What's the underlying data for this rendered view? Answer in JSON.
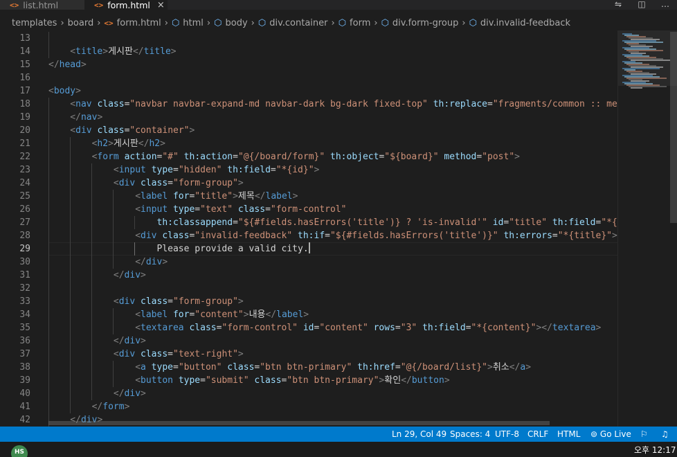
{
  "tabs": [
    {
      "label": "list.html",
      "icon": "html-file-icon",
      "active": false
    },
    {
      "label": "form.html",
      "icon": "html-file-icon",
      "active": true
    }
  ],
  "tab_close_glyph": "×",
  "html_icon_glyph": "<>",
  "breadcrumb": [
    "templates",
    "board",
    "form.html",
    "html",
    "body",
    "div.container",
    "form",
    "div.form-group",
    "div.invalid-feedback"
  ],
  "editor": {
    "active_line": 29,
    "lines": [
      {
        "n": 13,
        "indent": 1,
        "parts": []
      },
      {
        "n": 14,
        "indent": 1,
        "parts": [
          [
            "p",
            "<"
          ],
          [
            "tag",
            "title"
          ],
          [
            "p",
            ">"
          ],
          [
            "txt",
            "게시판"
          ],
          [
            "p",
            "</"
          ],
          [
            "tag",
            "title"
          ],
          [
            "p",
            ">"
          ]
        ]
      },
      {
        "n": 15,
        "indent": 0,
        "parts": [
          [
            "p",
            "</"
          ],
          [
            "tag",
            "head"
          ],
          [
            "p",
            ">"
          ]
        ]
      },
      {
        "n": 16,
        "indent": 0,
        "parts": []
      },
      {
        "n": 17,
        "indent": 0,
        "parts": [
          [
            "p",
            "<"
          ],
          [
            "tag",
            "body"
          ],
          [
            "p",
            ">"
          ]
        ]
      },
      {
        "n": 18,
        "indent": 1,
        "parts": [
          [
            "p",
            "<"
          ],
          [
            "tag",
            "nav"
          ],
          [
            "txt",
            " "
          ],
          [
            "attr",
            "class"
          ],
          [
            "eq",
            "="
          ],
          [
            "str",
            "\"navbar navbar-expand-md navbar-dark bg-dark fixed-top\""
          ],
          [
            "txt",
            " "
          ],
          [
            "attr",
            "th:replace"
          ],
          [
            "eq",
            "="
          ],
          [
            "str",
            "\"fragments/common :: menu"
          ]
        ]
      },
      {
        "n": 19,
        "indent": 1,
        "parts": [
          [
            "p",
            "</"
          ],
          [
            "tag",
            "nav"
          ],
          [
            "p",
            ">"
          ]
        ]
      },
      {
        "n": 20,
        "indent": 1,
        "parts": [
          [
            "p",
            "<"
          ],
          [
            "tag",
            "div"
          ],
          [
            "txt",
            " "
          ],
          [
            "attr",
            "class"
          ],
          [
            "eq",
            "="
          ],
          [
            "str",
            "\"container\""
          ],
          [
            "p",
            ">"
          ]
        ]
      },
      {
        "n": 21,
        "indent": 2,
        "parts": [
          [
            "p",
            "<"
          ],
          [
            "tag",
            "h2"
          ],
          [
            "p",
            ">"
          ],
          [
            "txt",
            "게시판"
          ],
          [
            "p",
            "</"
          ],
          [
            "tag",
            "h2"
          ],
          [
            "p",
            ">"
          ]
        ]
      },
      {
        "n": 22,
        "indent": 2,
        "parts": [
          [
            "p",
            "<"
          ],
          [
            "tag",
            "form"
          ],
          [
            "txt",
            " "
          ],
          [
            "attr",
            "action"
          ],
          [
            "eq",
            "="
          ],
          [
            "str",
            "\"#\""
          ],
          [
            "txt",
            " "
          ],
          [
            "attr",
            "th:action"
          ],
          [
            "eq",
            "="
          ],
          [
            "str",
            "\"@{/board/form}\""
          ],
          [
            "txt",
            " "
          ],
          [
            "attr",
            "th:object"
          ],
          [
            "eq",
            "="
          ],
          [
            "str",
            "\"${board}\""
          ],
          [
            "txt",
            " "
          ],
          [
            "attr",
            "method"
          ],
          [
            "eq",
            "="
          ],
          [
            "str",
            "\"post\""
          ],
          [
            "p",
            ">"
          ]
        ]
      },
      {
        "n": 23,
        "indent": 3,
        "parts": [
          [
            "p",
            "<"
          ],
          [
            "tag",
            "input"
          ],
          [
            "txt",
            " "
          ],
          [
            "attr",
            "type"
          ],
          [
            "eq",
            "="
          ],
          [
            "str",
            "\"hidden\""
          ],
          [
            "txt",
            " "
          ],
          [
            "attr",
            "th:field"
          ],
          [
            "eq",
            "="
          ],
          [
            "str",
            "\"*{id}\""
          ],
          [
            "p",
            ">"
          ]
        ]
      },
      {
        "n": 24,
        "indent": 3,
        "parts": [
          [
            "p",
            "<"
          ],
          [
            "tag",
            "div"
          ],
          [
            "txt",
            " "
          ],
          [
            "attr",
            "class"
          ],
          [
            "eq",
            "="
          ],
          [
            "str",
            "\"form-group\""
          ],
          [
            "p",
            ">"
          ]
        ]
      },
      {
        "n": 25,
        "indent": 4,
        "parts": [
          [
            "p",
            "<"
          ],
          [
            "tag",
            "label"
          ],
          [
            "txt",
            " "
          ],
          [
            "attr",
            "for"
          ],
          [
            "eq",
            "="
          ],
          [
            "str",
            "\"title\""
          ],
          [
            "p",
            ">"
          ],
          [
            "txt",
            "제목"
          ],
          [
            "p",
            "</"
          ],
          [
            "tag",
            "label"
          ],
          [
            "p",
            ">"
          ]
        ]
      },
      {
        "n": 26,
        "indent": 4,
        "parts": [
          [
            "p",
            "<"
          ],
          [
            "tag",
            "input"
          ],
          [
            "txt",
            " "
          ],
          [
            "attr",
            "type"
          ],
          [
            "eq",
            "="
          ],
          [
            "str",
            "\"text\""
          ],
          [
            "txt",
            " "
          ],
          [
            "attr",
            "class"
          ],
          [
            "eq",
            "="
          ],
          [
            "str",
            "\"form-control\""
          ]
        ]
      },
      {
        "n": 27,
        "indent": 5,
        "parts": [
          [
            "attr",
            "th:classappend"
          ],
          [
            "eq",
            "="
          ],
          [
            "str",
            "\"${#fields.hasErrors('title')} ? 'is-invalid'\""
          ],
          [
            "txt",
            " "
          ],
          [
            "attr",
            "id"
          ],
          [
            "eq",
            "="
          ],
          [
            "str",
            "\"title\""
          ],
          [
            "txt",
            " "
          ],
          [
            "attr",
            "th:field"
          ],
          [
            "eq",
            "="
          ],
          [
            "str",
            "\"*{ti"
          ]
        ]
      },
      {
        "n": 28,
        "indent": 4,
        "parts": [
          [
            "p",
            "<"
          ],
          [
            "tag",
            "div"
          ],
          [
            "txt",
            " "
          ],
          [
            "attr",
            "class"
          ],
          [
            "eq",
            "="
          ],
          [
            "str",
            "\"invalid-feedback\""
          ],
          [
            "txt",
            " "
          ],
          [
            "attr",
            "th:if"
          ],
          [
            "eq",
            "="
          ],
          [
            "str",
            "\"${#fields.hasErrors('title')}\""
          ],
          [
            "txt",
            " "
          ],
          [
            "attr",
            "th:errors"
          ],
          [
            "eq",
            "="
          ],
          [
            "str",
            "\"*{title}\""
          ],
          [
            "p",
            ">"
          ]
        ]
      },
      {
        "n": 29,
        "indent": 5,
        "parts": [
          [
            "txt",
            "Please provide a valid city."
          ]
        ]
      },
      {
        "n": 30,
        "indent": 4,
        "parts": [
          [
            "p",
            "</"
          ],
          [
            "tag",
            "div"
          ],
          [
            "p",
            ">"
          ]
        ]
      },
      {
        "n": 31,
        "indent": 3,
        "parts": [
          [
            "p",
            "</"
          ],
          [
            "tag",
            "div"
          ],
          [
            "p",
            ">"
          ]
        ]
      },
      {
        "n": 32,
        "indent": 3,
        "parts": []
      },
      {
        "n": 33,
        "indent": 3,
        "parts": [
          [
            "p",
            "<"
          ],
          [
            "tag",
            "div"
          ],
          [
            "txt",
            " "
          ],
          [
            "attr",
            "class"
          ],
          [
            "eq",
            "="
          ],
          [
            "str",
            "\"form-group\""
          ],
          [
            "p",
            ">"
          ]
        ]
      },
      {
        "n": 34,
        "indent": 4,
        "parts": [
          [
            "p",
            "<"
          ],
          [
            "tag",
            "label"
          ],
          [
            "txt",
            " "
          ],
          [
            "attr",
            "for"
          ],
          [
            "eq",
            "="
          ],
          [
            "str",
            "\"content\""
          ],
          [
            "p",
            ">"
          ],
          [
            "txt",
            "내용"
          ],
          [
            "p",
            "</"
          ],
          [
            "tag",
            "label"
          ],
          [
            "p",
            ">"
          ]
        ]
      },
      {
        "n": 35,
        "indent": 4,
        "parts": [
          [
            "p",
            "<"
          ],
          [
            "tag",
            "textarea"
          ],
          [
            "txt",
            " "
          ],
          [
            "attr",
            "class"
          ],
          [
            "eq",
            "="
          ],
          [
            "str",
            "\"form-control\""
          ],
          [
            "txt",
            " "
          ],
          [
            "attr",
            "id"
          ],
          [
            "eq",
            "="
          ],
          [
            "str",
            "\"content\""
          ],
          [
            "txt",
            " "
          ],
          [
            "attr",
            "rows"
          ],
          [
            "eq",
            "="
          ],
          [
            "str",
            "\"3\""
          ],
          [
            "txt",
            " "
          ],
          [
            "attr",
            "th:field"
          ],
          [
            "eq",
            "="
          ],
          [
            "str",
            "\"*{content}\""
          ],
          [
            "p",
            "></"
          ],
          [
            "tag",
            "textarea"
          ],
          [
            "p",
            ">"
          ]
        ]
      },
      {
        "n": 36,
        "indent": 3,
        "parts": [
          [
            "p",
            "</"
          ],
          [
            "tag",
            "div"
          ],
          [
            "p",
            ">"
          ]
        ]
      },
      {
        "n": 37,
        "indent": 3,
        "parts": [
          [
            "p",
            "<"
          ],
          [
            "tag",
            "div"
          ],
          [
            "txt",
            " "
          ],
          [
            "attr",
            "class"
          ],
          [
            "eq",
            "="
          ],
          [
            "str",
            "\"text-right\""
          ],
          [
            "p",
            ">"
          ]
        ]
      },
      {
        "n": 38,
        "indent": 4,
        "parts": [
          [
            "p",
            "<"
          ],
          [
            "tag",
            "a"
          ],
          [
            "txt",
            " "
          ],
          [
            "attr",
            "type"
          ],
          [
            "eq",
            "="
          ],
          [
            "str",
            "\"button\""
          ],
          [
            "txt",
            " "
          ],
          [
            "attr",
            "class"
          ],
          [
            "eq",
            "="
          ],
          [
            "str",
            "\"btn btn-primary\""
          ],
          [
            "txt",
            " "
          ],
          [
            "attr",
            "th:href"
          ],
          [
            "eq",
            "="
          ],
          [
            "str",
            "\"@{/board/list}\""
          ],
          [
            "p",
            ">"
          ],
          [
            "txt",
            "취소"
          ],
          [
            "p",
            "</"
          ],
          [
            "tag",
            "a"
          ],
          [
            "p",
            ">"
          ]
        ]
      },
      {
        "n": 39,
        "indent": 4,
        "parts": [
          [
            "p",
            "<"
          ],
          [
            "tag",
            "button"
          ],
          [
            "txt",
            " "
          ],
          [
            "attr",
            "type"
          ],
          [
            "eq",
            "="
          ],
          [
            "str",
            "\"submit\""
          ],
          [
            "txt",
            " "
          ],
          [
            "attr",
            "class"
          ],
          [
            "eq",
            "="
          ],
          [
            "str",
            "\"btn btn-primary\""
          ],
          [
            "p",
            ">"
          ],
          [
            "txt",
            "확인"
          ],
          [
            "p",
            "</"
          ],
          [
            "tag",
            "button"
          ],
          [
            "p",
            ">"
          ]
        ]
      },
      {
        "n": 40,
        "indent": 3,
        "parts": [
          [
            "p",
            "</"
          ],
          [
            "tag",
            "div"
          ],
          [
            "p",
            ">"
          ]
        ]
      },
      {
        "n": 41,
        "indent": 2,
        "parts": [
          [
            "p",
            "</"
          ],
          [
            "tag",
            "form"
          ],
          [
            "p",
            ">"
          ]
        ]
      },
      {
        "n": 42,
        "indent": 1,
        "parts": [
          [
            "p",
            "</"
          ],
          [
            "tag",
            "div"
          ],
          [
            "p",
            ">"
          ]
        ]
      }
    ]
  },
  "status": {
    "position": "Ln 29, Col 49",
    "spaces": "Spaces: 4",
    "encoding": "UTF-8",
    "eol": "CRLF",
    "language": "HTML",
    "go_live": "Go Live"
  },
  "taskbar": {
    "avatar": "HS",
    "clock": "오후 12:17"
  },
  "colors": {
    "accent": "#007acc",
    "tag": "#569cd6",
    "attribute": "#9cdcfe",
    "string": "#ce9178",
    "punctuation": "#808080",
    "text": "#d4d4d4",
    "background": "#1e1e1e"
  }
}
